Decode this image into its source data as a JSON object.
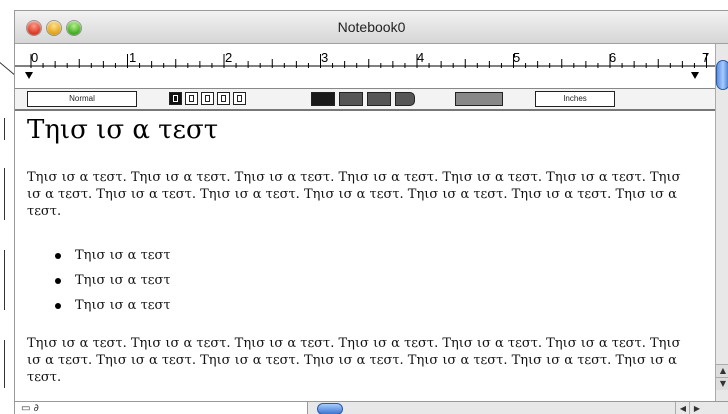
{
  "window": {
    "title": "Notebook0"
  },
  "ruler": {
    "numbers": [
      "0",
      "1",
      "2",
      "3",
      "4",
      "5",
      "6",
      "7"
    ]
  },
  "format_bar": {
    "style_value": "Normal",
    "units_value": "Inches"
  },
  "document": {
    "heading": "Τηισ ισ α τεστ",
    "paragraph1": "Τηισ ισ α τεστ. Τηισ ισ α τεστ. Τηισ ισ α τεστ. Τηισ ισ α τεστ. Τηισ ισ α τεστ. Τηισ ισ α τεστ. Τηισ ισ α τεστ. Τηισ ισ α τεστ. Τηισ ισ α τεστ. Τηισ ισ α τεστ. Τηισ ισ α τεστ. Τηισ ισ α τεστ. Τηισ ισ α τεστ.",
    "bullets": [
      "Τηισ ισ α τεστ",
      "Τηισ ισ α τεστ",
      "Τηισ ισ α τεστ"
    ],
    "paragraph2": "Τηισ ισ α τεστ. Τηισ ισ α τεστ. Τηισ ισ α τεστ. Τηισ ισ α τεστ. Τηισ ισ α τεστ. Τηισ ισ α τεστ. Τηισ ισ α τεστ. Τηισ ισ α τεστ. Τηισ ισ α τεστ. Τηισ ισ α τεστ. Τηισ ισ α τεστ. Τηισ ισ α τεστ. Τηισ ισ α τεστ."
  },
  "icons": {
    "close": "close-icon",
    "minimize": "minimize-icon",
    "zoom": "zoom-icon",
    "scroll_up": "arrow-up-icon",
    "scroll_down": "arrow-down-icon",
    "scroll_left": "arrow-left-icon",
    "scroll_right": "arrow-right-icon",
    "page": "page-icon"
  },
  "colors": {
    "scroll_thumb": "#5a8fe0",
    "close": "#d8321c",
    "minimize": "#e0a010",
    "zoom": "#3aa81c"
  }
}
